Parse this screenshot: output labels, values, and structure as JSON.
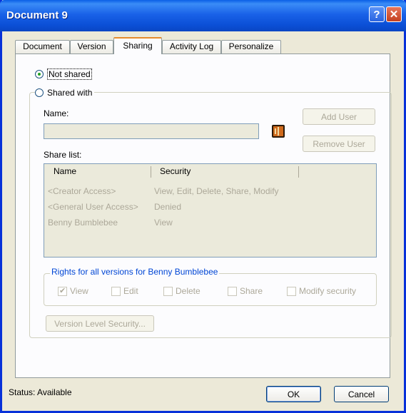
{
  "window": {
    "title": "Document 9",
    "help_glyph": "?",
    "close_glyph": "✕"
  },
  "tabs": [
    {
      "label": "Document"
    },
    {
      "label": "Version"
    },
    {
      "label": "Sharing",
      "active": true
    },
    {
      "label": "Activity Log"
    },
    {
      "label": "Personalize"
    }
  ],
  "sharing": {
    "not_shared_label": "Not shared",
    "shared_with_label": "Shared with",
    "name_label": "Name:",
    "name_value": "",
    "add_user_label": "Add User",
    "remove_user_label": "Remove User",
    "share_list_label": "Share list:",
    "columns": [
      "Name",
      "Security"
    ],
    "rows": [
      {
        "name": "<Creator Access>",
        "security": "View, Edit, Delete, Share, Modify"
      },
      {
        "name": "<General User Access>",
        "security": "Denied"
      },
      {
        "name": "Benny Bumblebee",
        "security": "View"
      }
    ],
    "rights_title": "Rights for all versions for Benny Bumblebee",
    "rights": [
      {
        "label": "View",
        "checked": true
      },
      {
        "label": "Edit",
        "checked": false
      },
      {
        "label": "Delete",
        "checked": false
      },
      {
        "label": "Share",
        "checked": false
      },
      {
        "label": "Modify security",
        "checked": false
      }
    ],
    "version_level_security_label": "Version Level Security..."
  },
  "footer": {
    "status": "Status: Available",
    "ok_label": "OK",
    "cancel_label": "Cancel"
  },
  "colors": {
    "title_bar": "#0a5fe6",
    "dialog_bg": "#ece9d8",
    "group_title": "#0046d5"
  }
}
